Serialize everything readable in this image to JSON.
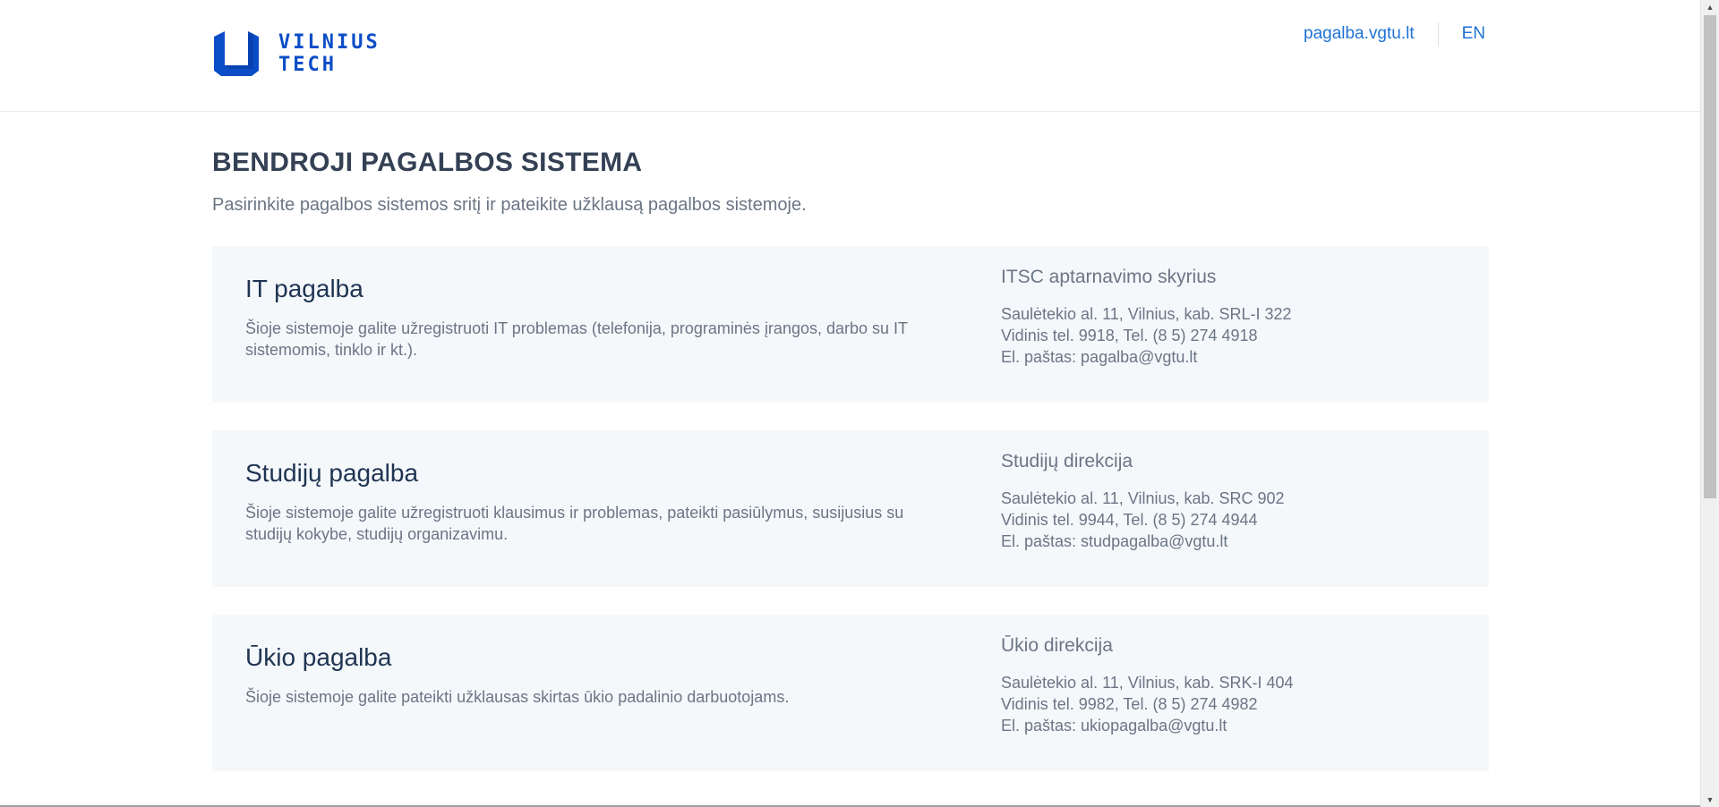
{
  "header": {
    "logo": {
      "line1": "VILNIUS",
      "line2": "TECH",
      "brand_color": "#0b4dc7"
    },
    "nav": {
      "home_link": "pagalba.vgtu.lt",
      "language_link": "EN",
      "link_color": "#1f72d6"
    }
  },
  "main": {
    "title": "BENDROJI PAGALBOS SISTEMA",
    "subtitle": "Pasirinkite pagalbos sistemos sritį ir pateikite užklausą pagalbos sistemoje.",
    "cards": [
      {
        "title": "IT pagalba",
        "description": "Šioje sistemoje galite užregistruoti IT problemas (telefonija, programinės įrangos, darbo su IT sistemomis, tinklo ir kt.).",
        "contact": {
          "department": "ITSC aptarnavimo skyrius",
          "address": "Saulėtekio al. 11, Vilnius, kab. SRL-I 322",
          "phone": "Vidinis tel. 9918, Tel. (8 5) 274 4918",
          "email": "El. paštas: pagalba@vgtu.lt"
        }
      },
      {
        "title": "Studijų pagalba",
        "description": "Šioje sistemoje galite užregistruoti klausimus ir problemas, pateikti pasiūlymus, susijusius su studijų kokybe, studijų organizavimu.",
        "contact": {
          "department": "Studijų direkcija",
          "address": "Saulėtekio al. 11, Vilnius, kab. SRC 902",
          "phone": "Vidinis tel. 9944, Tel. (8 5) 274 4944",
          "email": "El. paštas: studpagalba@vgtu.lt"
        }
      },
      {
        "title": "Ūkio pagalba",
        "description": "Šioje sistemoje galite pateikti užklausas skirtas ūkio padalinio darbuotojams.",
        "contact": {
          "department": "Ūkio direkcija",
          "address": "Saulėtekio al. 11, Vilnius, kab. SRK-I 404",
          "phone": "Vidinis tel. 9982, Tel. (8 5) 274 4982",
          "email": "El. paštas: ukiopagalba@vgtu.lt"
        }
      }
    ]
  },
  "icons": {
    "logo_mark": "vilnius-tech-logo-icon",
    "scroll_up": "chevron-up-icon",
    "scroll_down": "chevron-down-icon"
  },
  "colors": {
    "card_background": "#f5f8fb",
    "title_text": "#344054",
    "card_title_text": "#1e3452",
    "body_text": "#6b7585"
  }
}
